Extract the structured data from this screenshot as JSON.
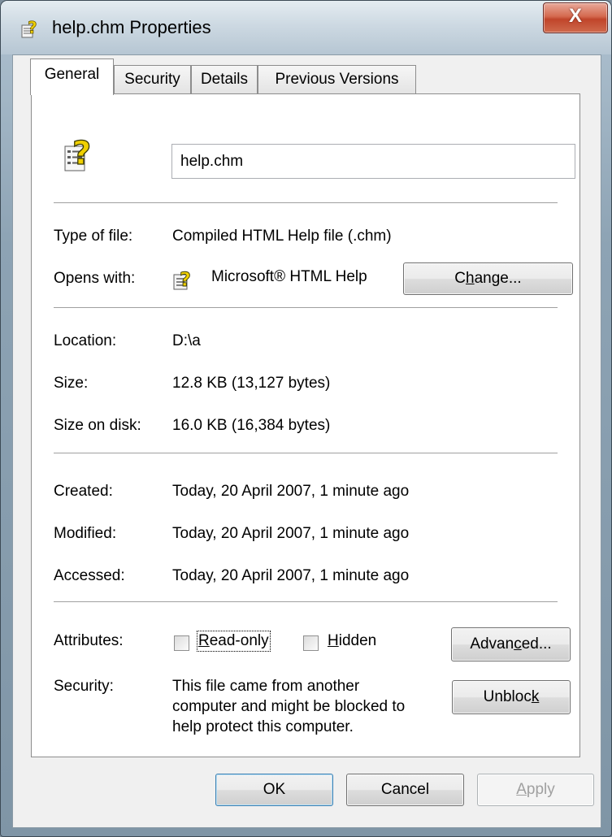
{
  "window": {
    "title": "help.chm Properties",
    "close_glyph": "X"
  },
  "tabs": [
    {
      "label": "General"
    },
    {
      "label": "Security"
    },
    {
      "label": "Details"
    },
    {
      "label": "Previous Versions"
    }
  ],
  "general": {
    "file_name": "help.chm",
    "type_label": "Type of file:",
    "type_value": "Compiled HTML Help file (.chm)",
    "opens_label": "Opens with:",
    "opens_value": "Microsoft® HTML Help",
    "change_pre": "C",
    "change_ul": "h",
    "change_post": "ange...",
    "location_label": "Location:",
    "location_value": "D:\\a",
    "size_label": "Size:",
    "size_value": "12.8 KB (13,127 bytes)",
    "size_disk_label": "Size on disk:",
    "size_disk_value": "16.0 KB (16,384 bytes)",
    "created_label": "Created:",
    "created_value": "Today, 20 April 2007, 1 minute ago",
    "modified_label": "Modified:",
    "modified_value": "Today, 20 April 2007, 1 minute ago",
    "accessed_label": "Accessed:",
    "accessed_value": "Today, 20 April 2007, 1 minute ago",
    "attributes_label": "Attributes:",
    "readonly_ul": "R",
    "readonly_post": "ead-only",
    "hidden_ul": "H",
    "hidden_post": "idden",
    "advanced_pre": "Advan",
    "advanced_ul": "c",
    "advanced_post": "ed...",
    "security_label": "Security:",
    "security_text_1": "This file came from another",
    "security_text_2": "computer and might be blocked to",
    "security_text_3": "help protect this computer.",
    "unblock_pre": "Unbloc",
    "unblock_ul": "k",
    "unblock_post": ""
  },
  "buttons": {
    "ok": "OK",
    "cancel": "Cancel",
    "apply_ul": "A",
    "apply_post": "pply"
  },
  "state": {
    "readonly_checked": false,
    "hidden_checked": false,
    "apply_enabled": false
  },
  "colors": {
    "close_button": "#c0452b",
    "help_icon_yellow": "#f0d000"
  },
  "icons": {
    "file": "chm-help-file-icon",
    "app": "html-help-app-icon",
    "close": "close-icon"
  }
}
